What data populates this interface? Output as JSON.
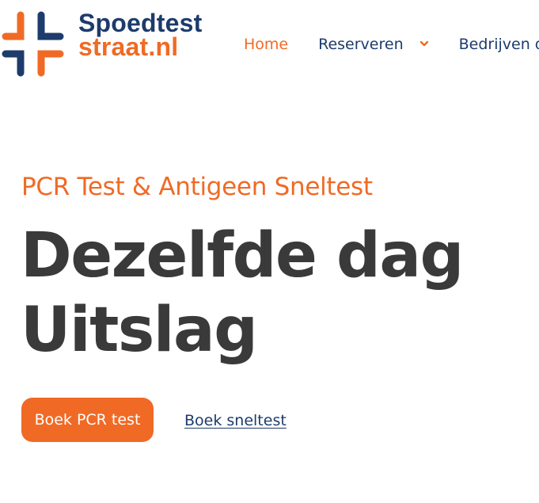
{
  "header": {
    "logo": {
      "line1": "Spoedtest",
      "line2": "straat.nl",
      "icon": "cross-logo-icon",
      "colors": {
        "navy": "#1d3b6b",
        "orange": "#f06a25"
      }
    },
    "nav": {
      "home": "Home",
      "reserveren": "Reserveren",
      "bedrijven": "Bedrijven o"
    }
  },
  "hero": {
    "eyebrow": "PCR Test & Antigeen Sneltest",
    "headline_line1": "Dezelfde dag",
    "headline_line2": "Uitslag",
    "primary_button": "Boek PCR test",
    "secondary_link": "Boek sneltest"
  },
  "colors": {
    "accent": "#f06a25",
    "brand": "#1d3b6b",
    "headline": "#3a3a3a",
    "background": "#ffffff"
  }
}
